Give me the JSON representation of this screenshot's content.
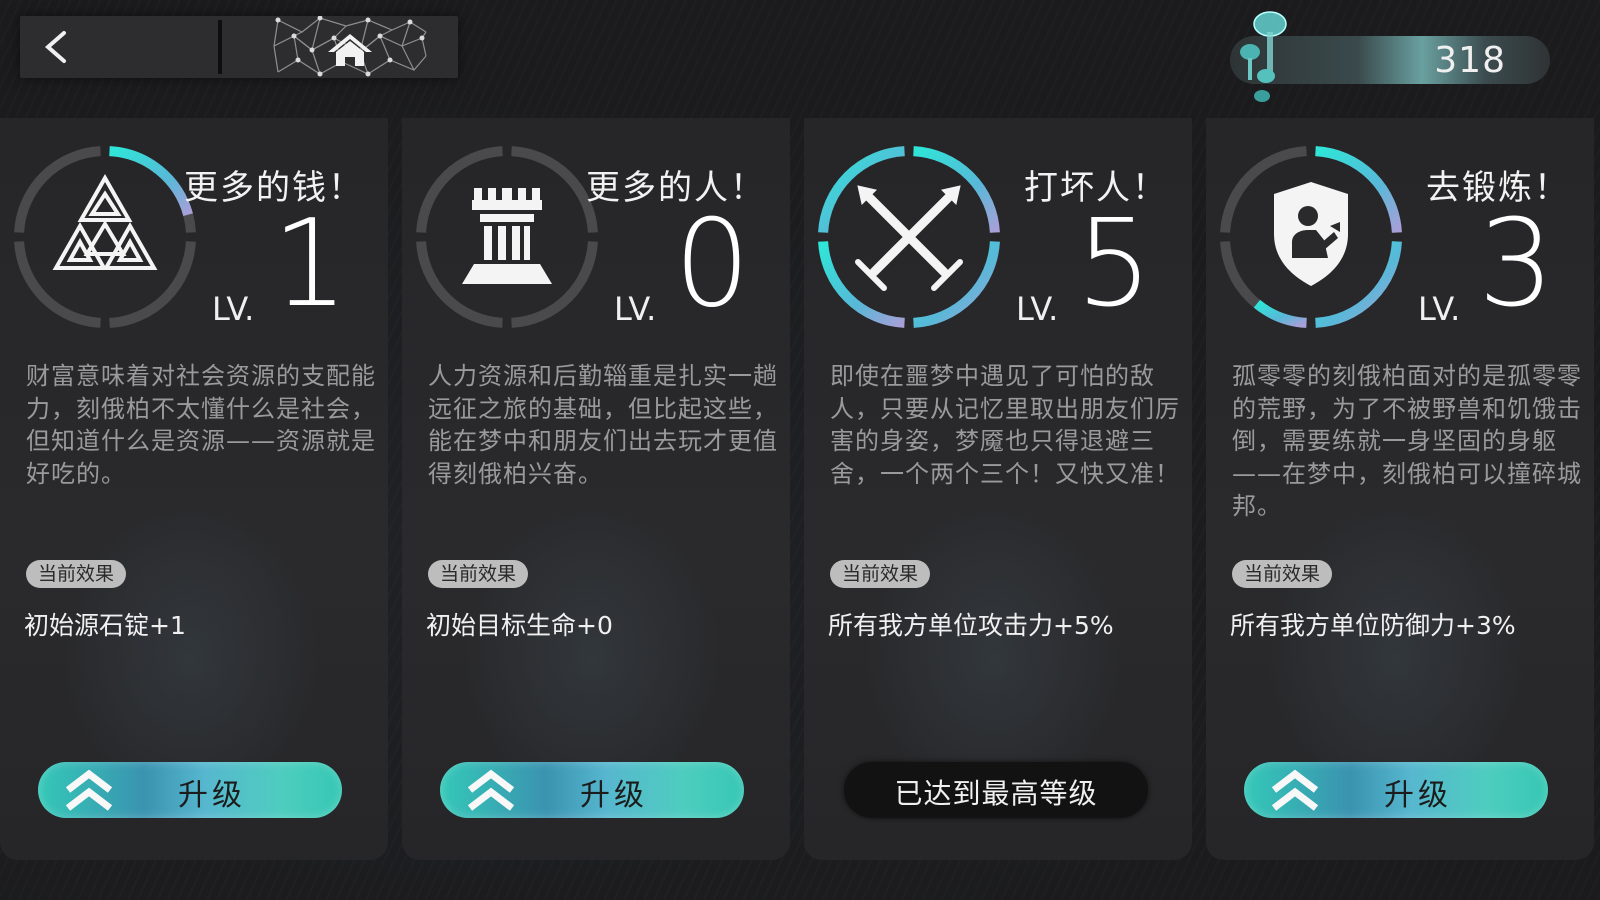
{
  "currency": {
    "value": "318",
    "icon": "mushroom-cluster-icon"
  },
  "nav": {
    "back_icon": "chevron-left-icon",
    "home_icon": "home-icon"
  },
  "effect_badge": "当前效果",
  "upgrade_label": "升级",
  "max_label": "已达到最高等级",
  "lv_prefix": "LV.",
  "colors": {
    "ring_active": "#2ee6d8",
    "ring_inactive": "#4a4a4c",
    "button": "#3fc6c0"
  },
  "cards": [
    {
      "title": "更多的钱！",
      "icon": "triangles-icon",
      "level": "1",
      "progress": 0.2,
      "desc": "财富意味着对社会资源的支配能力，刻俄柏不太懂什么是社会，但知道什么是资源——资源就是好吃的。",
      "effect": "初始源石锭+1",
      "maxed": false
    },
    {
      "title": "更多的人！",
      "icon": "rook-tower-icon",
      "level": "0",
      "progress": 0.0,
      "desc": "人力资源和后勤辎重是扎实一趟远征之旅的基础，但比起这些，能在梦中和朋友们出去玩才更值得刻俄柏兴奋。",
      "effect": "初始目标生命+0",
      "maxed": false
    },
    {
      "title": "打坏人！",
      "icon": "crossed-swords-icon",
      "level": "5",
      "progress": 1.0,
      "desc": "即使在噩梦中遇见了可怕的敌人，只要从记忆里取出朋友们厉害的身姿，梦魇也只得退避三舍，一个两个三个！又快又准！",
      "effect": "所有我方单位攻击力+5%",
      "maxed": true
    },
    {
      "title": "去锻炼！",
      "icon": "shield-person-icon",
      "level": "3",
      "progress": 0.6,
      "desc": "孤零零的刻俄柏面对的是孤零零的荒野，为了不被野兽和饥饿击倒，需要练就一身坚固的身躯——在梦中，刻俄柏可以撞碎城邦。",
      "effect": "所有我方单位防御力+3%",
      "maxed": false
    }
  ]
}
